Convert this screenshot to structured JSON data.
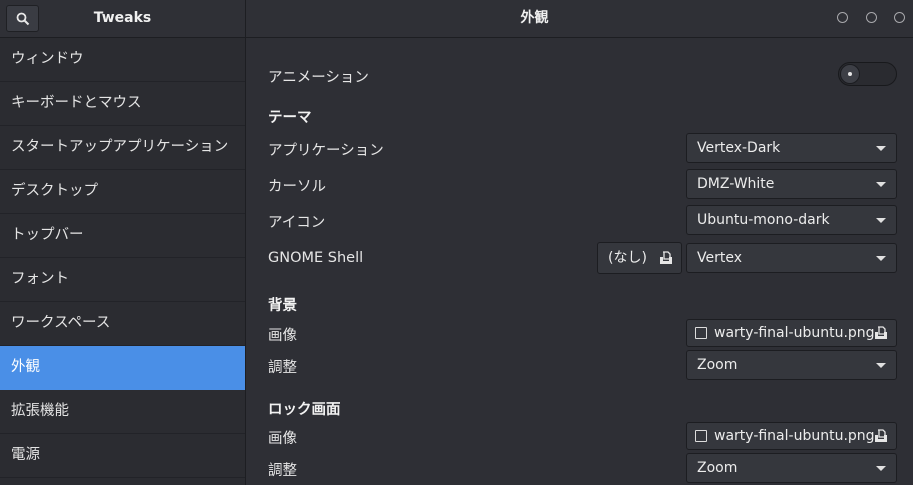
{
  "header": {
    "app_title": "Tweaks",
    "window_title": "外観"
  },
  "sidebar": {
    "items": [
      {
        "label": "ウィンドウ"
      },
      {
        "label": "キーボードとマウス"
      },
      {
        "label": "スタートアップアプリケーション"
      },
      {
        "label": "デスクトップ"
      },
      {
        "label": "トップバー"
      },
      {
        "label": "フォント"
      },
      {
        "label": "ワークスペース"
      },
      {
        "label": "外観",
        "active": true
      },
      {
        "label": "拡張機能"
      },
      {
        "label": "電源"
      }
    ],
    "active_color": "#4a8fe7"
  },
  "main": {
    "animation": {
      "label": "アニメーション",
      "enabled": false
    },
    "theme": {
      "heading": "テーマ",
      "applications": {
        "label": "アプリケーション",
        "value": "Vertex-Dark"
      },
      "cursor": {
        "label": "カーソル",
        "value": "DMZ-White"
      },
      "icons": {
        "label": "アイコン",
        "value": "Ubuntu-mono-dark"
      },
      "shell": {
        "label": "GNOME Shell",
        "file_value": "(なし)",
        "value": "Vertex"
      }
    },
    "background": {
      "heading": "背景",
      "image": {
        "label": "画像",
        "value": "warty-final-ubuntu.png"
      },
      "adjustment": {
        "label": "調整",
        "value": "Zoom"
      }
    },
    "lock_screen": {
      "heading": "ロック画面",
      "image": {
        "label": "画像",
        "value": "warty-final-ubuntu.png"
      },
      "adjustment": {
        "label": "調整",
        "value": "Zoom"
      }
    }
  },
  "icons": {
    "search": "search-icon",
    "file_open": "file-open-icon",
    "document": "document-icon",
    "dropdown": "chevron-down-icon"
  }
}
